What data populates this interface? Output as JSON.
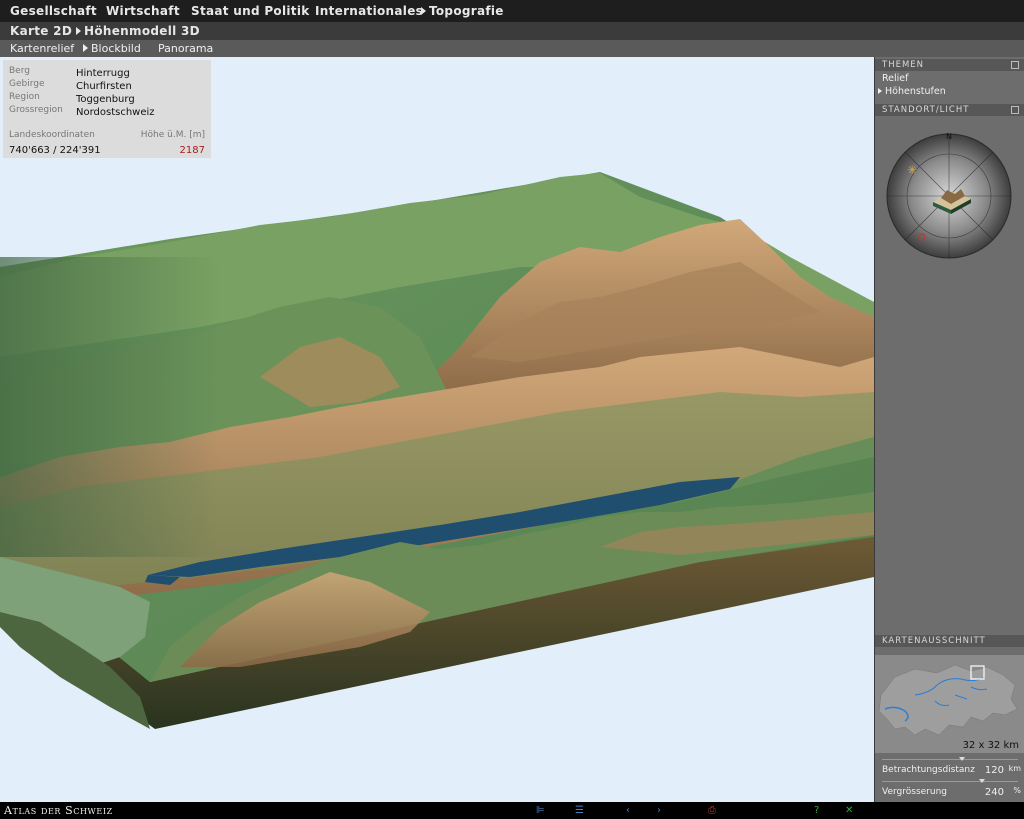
{
  "topnav": {
    "items": [
      "Gesellschaft",
      "Wirtschaft",
      "Staat und Politik",
      "Internationales",
      "Topografie"
    ]
  },
  "subnav": {
    "items": [
      "Karte 2D",
      "Höhenmodell 3D"
    ]
  },
  "subnav2": {
    "items": [
      "Kartenrelief",
      "Blockbild",
      "Panorama"
    ]
  },
  "info": {
    "rows": [
      {
        "label": "Berg",
        "value": "Hinterrugg"
      },
      {
        "label": "Gebirge",
        "value": "Churfirsten"
      },
      {
        "label": "Region",
        "value": "Toggenburg"
      },
      {
        "label": "Grossregion",
        "value": "Nordostschweiz"
      }
    ],
    "coords_label": "Landeskoordinaten",
    "height_label": "Höhe ü.M. [m]",
    "coords_value": "740'663 / 224'391",
    "height_value": "2187",
    "height_color": "#a21e1e"
  },
  "panel": {
    "themen_title": "THEMEN",
    "themes": [
      "Relief",
      "Höhenstufen"
    ],
    "standort_title": "STANDORT/LICHT",
    "north": "N",
    "kartenausschnitt_title": "KARTENAUSSCHNITT",
    "scale": "32 x 32 km",
    "distance_label": "Betrachtungsdistanz",
    "distance_value": "120",
    "distance_unit": "km",
    "zoom_label": "Vergrösserung",
    "zoom_value": "240",
    "zoom_unit": "%"
  },
  "footer": {
    "brand": "Atlas der Schweiz",
    "icons": [
      "legend-icon",
      "list-icon",
      "back-arrow-icon",
      "forward-arrow-icon",
      "print-icon",
      "help-icon",
      "exit-icon"
    ]
  },
  "colors": {
    "sky": "#e2effa",
    "lake": "#1f4e6e",
    "meadow": "#5e8a5a",
    "rock": "#b89266"
  }
}
